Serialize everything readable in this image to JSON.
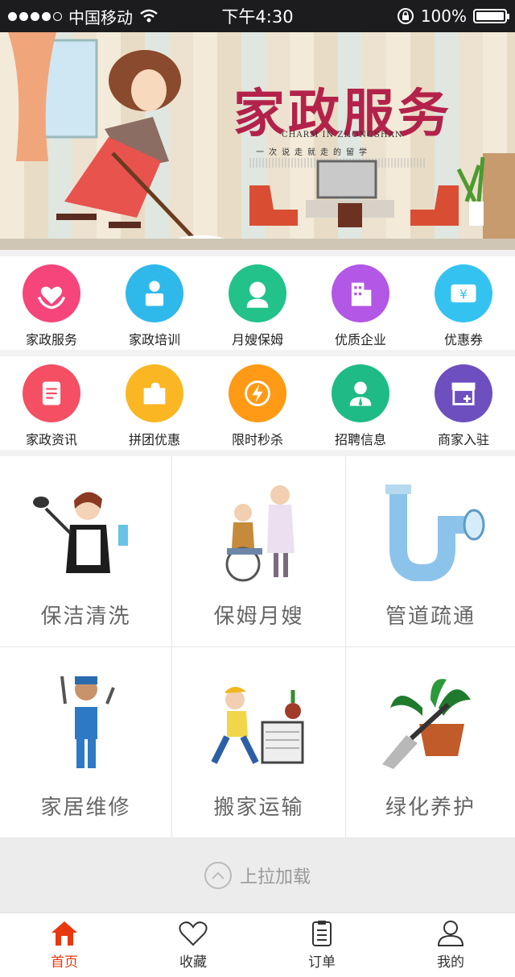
{
  "status_bar": {
    "carrier": "中国移动",
    "time": "下午4:30",
    "battery": "100%"
  },
  "banner": {
    "title": "家政服务",
    "subtitle": "CHARM IN ZHONGSHAN",
    "slogan": "一次说走就走的留学"
  },
  "quick_row_1": [
    {
      "label": "家政服务",
      "icon": "heart-hands-icon",
      "color": "#f5457a"
    },
    {
      "label": "家政培训",
      "icon": "trainer-icon",
      "color": "#2fb8ea"
    },
    {
      "label": "月嫂保姆",
      "icon": "nanny-icon",
      "color": "#22c28a"
    },
    {
      "label": "优质企业",
      "icon": "building-icon",
      "color": "#b257e6"
    },
    {
      "label": "优惠券",
      "icon": "coupon-icon",
      "color": "#34c2f0"
    }
  ],
  "quick_row_2": [
    {
      "label": "家政资讯",
      "icon": "news-icon",
      "color": "#f44f63"
    },
    {
      "label": "拼团优惠",
      "icon": "puzzle-icon",
      "color": "#fbb624"
    },
    {
      "label": "限时秒杀",
      "icon": "lightning-icon",
      "color": "#ff9a16"
    },
    {
      "label": "招聘信息",
      "icon": "recruit-icon",
      "color": "#1fbb86"
    },
    {
      "label": "商家入驻",
      "icon": "shop-icon",
      "color": "#6d4fbf"
    }
  ],
  "services": [
    {
      "label": "保洁清洗",
      "icon": "cleaning-icon"
    },
    {
      "label": "保姆月嫂",
      "icon": "caregiver-icon"
    },
    {
      "label": "管道疏通",
      "icon": "pipe-icon"
    },
    {
      "label": "家居维修",
      "icon": "repairman-icon"
    },
    {
      "label": "搬家运输",
      "icon": "moving-icon"
    },
    {
      "label": "绿化养护",
      "icon": "gardening-icon"
    }
  ],
  "load_more": "上拉加载",
  "tabs": [
    {
      "label": "首页",
      "icon": "home-icon",
      "active": true
    },
    {
      "label": "收藏",
      "icon": "heart-icon",
      "active": false
    },
    {
      "label": "订单",
      "icon": "order-icon",
      "active": false
    },
    {
      "label": "我的",
      "icon": "user-icon",
      "active": false
    }
  ],
  "colors": {
    "accent": "#e8380d",
    "banner_title": "#b3224a"
  }
}
